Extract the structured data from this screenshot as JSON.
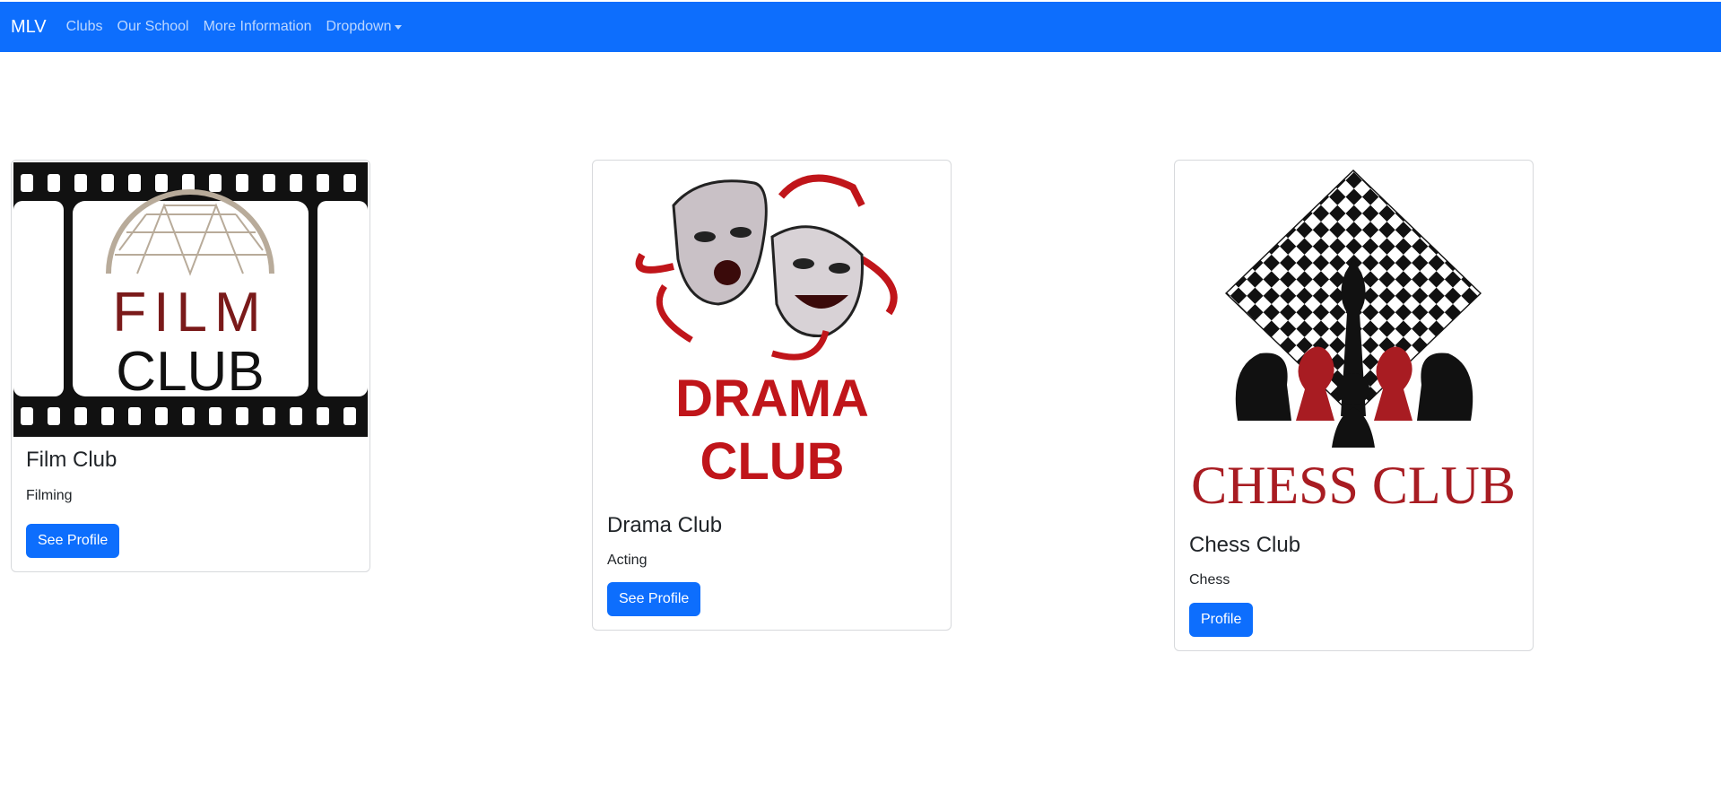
{
  "navbar": {
    "brand": "MLV",
    "links": [
      {
        "label": "Clubs"
      },
      {
        "label": "Our School"
      },
      {
        "label": "More Information"
      },
      {
        "label": "Dropdown"
      }
    ]
  },
  "cards": [
    {
      "title": "Film Club",
      "text": "Filming",
      "button": "See Profile",
      "logo_text": [
        "FILM",
        "CLUB"
      ]
    },
    {
      "title": "Drama Club",
      "text": "Acting",
      "button": "See Profile",
      "logo_text": [
        "DRAMA",
        "CLUB"
      ]
    },
    {
      "title": "Chess Club",
      "text": "Chess",
      "button": "Profile",
      "logo_text": [
        "CHESS CLUB"
      ]
    }
  ],
  "colors": {
    "primary": "#0d6efd",
    "film_red": "#7a1a1a",
    "drama_red": "#c0151a",
    "chess_red": "#a81c22"
  }
}
